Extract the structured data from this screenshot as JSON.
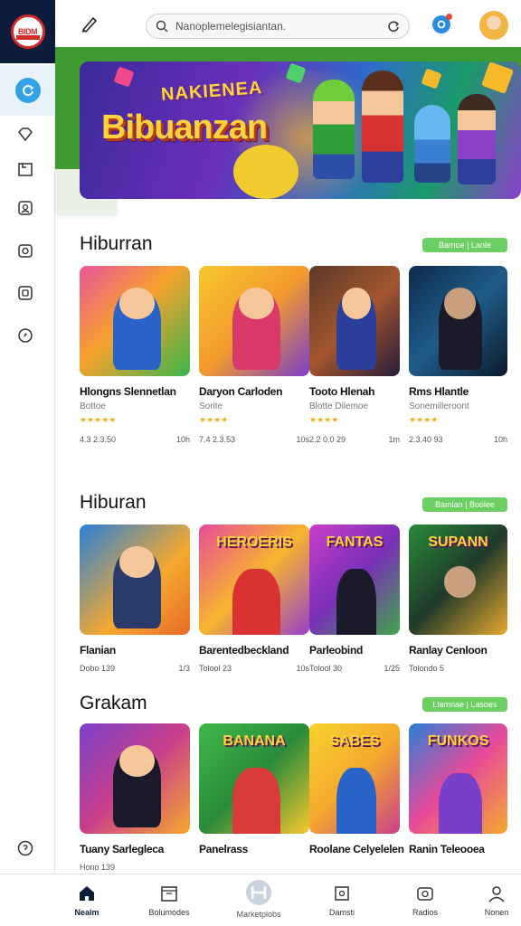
{
  "app": {
    "logo_text": "BIDM"
  },
  "topbar": {
    "search_text": "Nanoplemelegisiantan."
  },
  "banner": {
    "subtitle": "NAKIENEA",
    "title": "Bibuanzan"
  },
  "sections": [
    {
      "title": "Hiburran",
      "see_all": "Bamoe | Lanle",
      "cards": [
        {
          "title": "Hlongns Slennetlan",
          "sub": "Bottoe",
          "stars": "★★★★★",
          "meta_left": "4.3 2.3.50",
          "meta_right": "10h",
          "art": "art1"
        },
        {
          "title": "Daryon Carloden",
          "sub": "Sorite",
          "stars": "★★★★",
          "meta_left": "7.4 2.3.53",
          "meta_right": "10s",
          "art": "art2"
        },
        {
          "title": "Tooto Hlenah",
          "sub": "Blotte Dilemoe",
          "stars": "★★★★",
          "meta_left": "2.2 0.0 29",
          "meta_right": "1m",
          "art": "art3"
        },
        {
          "title": "Rms Hlantle",
          "sub": "Sonemilleroont",
          "stars": "★★★★",
          "meta_left": "2.3.40 93",
          "meta_right": "10h",
          "art": "art4"
        }
      ]
    },
    {
      "title": "Hiburan",
      "see_all": "Bamlan | Boolee",
      "cards": [
        {
          "title": "Flanian",
          "meta_left": "Dobo 139",
          "meta_right": "1/3",
          "art": "art5",
          "word": ""
        },
        {
          "title": "Barentedbeckland",
          "meta_left": "Tolool 23",
          "meta_right": "10s",
          "art": "art6",
          "word": "HEROERIS"
        },
        {
          "title": "Parleobind",
          "meta_left": "Tolool 30",
          "meta_right": "1/25",
          "art": "art7",
          "word": "FANTAS"
        },
        {
          "title": "Ranlay Cenloon",
          "meta_left": "Tolondo 5",
          "meta_right": "",
          "art": "art8",
          "word": "SUPANN"
        }
      ]
    },
    {
      "title": "Grakam",
      "see_all": "Llamnae | Lasoes",
      "cards": [
        {
          "title": "Tuany Sarlegleca",
          "meta_left": "Hono 139",
          "meta_right": "",
          "art": "art9",
          "word": ""
        },
        {
          "title": "Panelrass",
          "meta_left": "",
          "meta_right": "",
          "art": "art10",
          "word": "BANANA"
        },
        {
          "title": "Roolane Celyelelen",
          "meta_left": "",
          "meta_right": "",
          "art": "art11",
          "word": "SABES"
        },
        {
          "title": "Ranin Teleooea",
          "meta_left": "",
          "meta_right": "",
          "art": "art12",
          "word": "FUNKOS"
        }
      ]
    }
  ],
  "bottom_nav": [
    {
      "label": "Nealm",
      "icon": "home-icon"
    },
    {
      "label": "Bolumodes",
      "icon": "calendar-icon"
    },
    {
      "label": "Marketplobs",
      "icon": "marketplace-icon"
    },
    {
      "label": "Damsti",
      "icon": "square-icon"
    },
    {
      "label": "Radios",
      "icon": "radio-icon"
    },
    {
      "label": "Nonen",
      "icon": "profile-icon"
    }
  ],
  "colors": {
    "accent_green": "#6bcf63",
    "banner_green": "#3f9b2f",
    "sidebar_dark": "#0d1b3d",
    "active_blue": "#34a3e6"
  }
}
